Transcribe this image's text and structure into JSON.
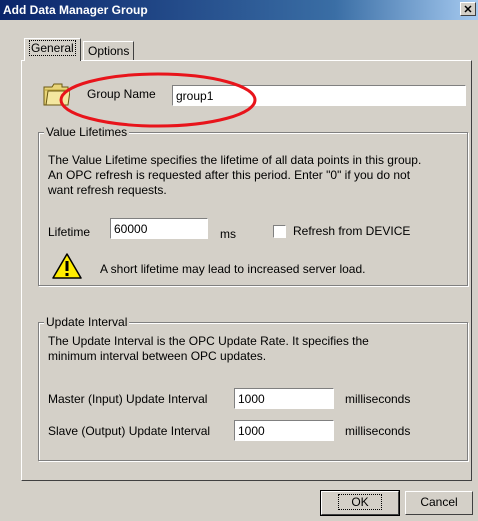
{
  "window": {
    "title": "Add Data Manager Group",
    "close_glyph": "✕"
  },
  "tabs": [
    {
      "label": "General",
      "active": true
    },
    {
      "label": "Options",
      "active": false
    }
  ],
  "group_name": {
    "label": "Group Name",
    "value": "group1",
    "icon": "folder-icon"
  },
  "value_lifetimes": {
    "legend": "Value Lifetimes",
    "description_line1": "The Value Lifetime specifies the lifetime of all data points in this group.",
    "description_line2": "An OPC refresh is requested after this period.  Enter \"0\" if you do not",
    "description_line3": "want refresh requests.",
    "lifetime_label": "Lifetime",
    "lifetime_value": "60000",
    "lifetime_unit": "ms",
    "refresh_label": "Refresh from DEVICE",
    "refresh_checked": false,
    "warning_icon": "warning-icon",
    "warning_text": "A short lifetime may lead to increased server load."
  },
  "update_interval": {
    "legend": "Update Interval",
    "description_line1": "The Update Interval is the OPC Update Rate.  It specifies the",
    "description_line2": "minimum interval between OPC updates.",
    "master_label": "Master (Input) Update Interval",
    "master_value": "1000",
    "master_unit": "milliseconds",
    "slave_label": "Slave (Output) Update Interval",
    "slave_value": "1000",
    "slave_unit": "milliseconds"
  },
  "buttons": {
    "ok": "OK",
    "cancel": "Cancel"
  },
  "colors": {
    "annotation": "#e8141b",
    "dialog_bg": "#d4d0c8",
    "title_bar": "#0a246a"
  }
}
